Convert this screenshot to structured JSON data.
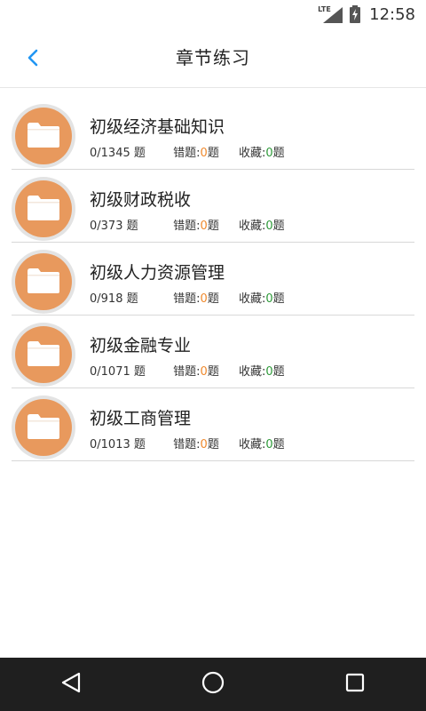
{
  "status_bar": {
    "network": "LTE",
    "time": "12:58"
  },
  "header": {
    "back_icon": "chevron-left-icon",
    "title": "章节练习",
    "accent_color": "#2196f3"
  },
  "items": [
    {
      "title": "初级经济基础知识",
      "progress": "0/1345 题",
      "wrong_label": "错题:",
      "wrong_count": "0",
      "wrong_unit": "题",
      "fav_label": "收藏:",
      "fav_count": "0",
      "fav_unit": "题"
    },
    {
      "title": "初级财政税收",
      "progress": "0/373 题",
      "wrong_label": "错题:",
      "wrong_count": "0",
      "wrong_unit": "题",
      "fav_label": "收藏:",
      "fav_count": "0",
      "fav_unit": "题"
    },
    {
      "title": "初级人力资源管理",
      "progress": "0/918 题",
      "wrong_label": "错题:",
      "wrong_count": "0",
      "wrong_unit": "题",
      "fav_label": "收藏:",
      "fav_count": "0",
      "fav_unit": "题"
    },
    {
      "title": "初级金融专业",
      "progress": "0/1071 题",
      "wrong_label": "错题:",
      "wrong_count": "0",
      "wrong_unit": "题",
      "fav_label": "收藏:",
      "fav_count": "0",
      "fav_unit": "题"
    },
    {
      "title": "初级工商管理",
      "progress": "0/1013 题",
      "wrong_label": "错题:",
      "wrong_count": "0",
      "wrong_unit": "题",
      "fav_label": "收藏:",
      "fav_count": "0",
      "fav_unit": "题"
    }
  ],
  "colors": {
    "folder_circle": "#e8995d",
    "wrong_count": "#ef8a2e",
    "fav_count": "#2f9a3a"
  },
  "nav_bar": {
    "back_icon": "triangle-back-icon",
    "home_icon": "circle-home-icon",
    "recents_icon": "square-recents-icon"
  }
}
